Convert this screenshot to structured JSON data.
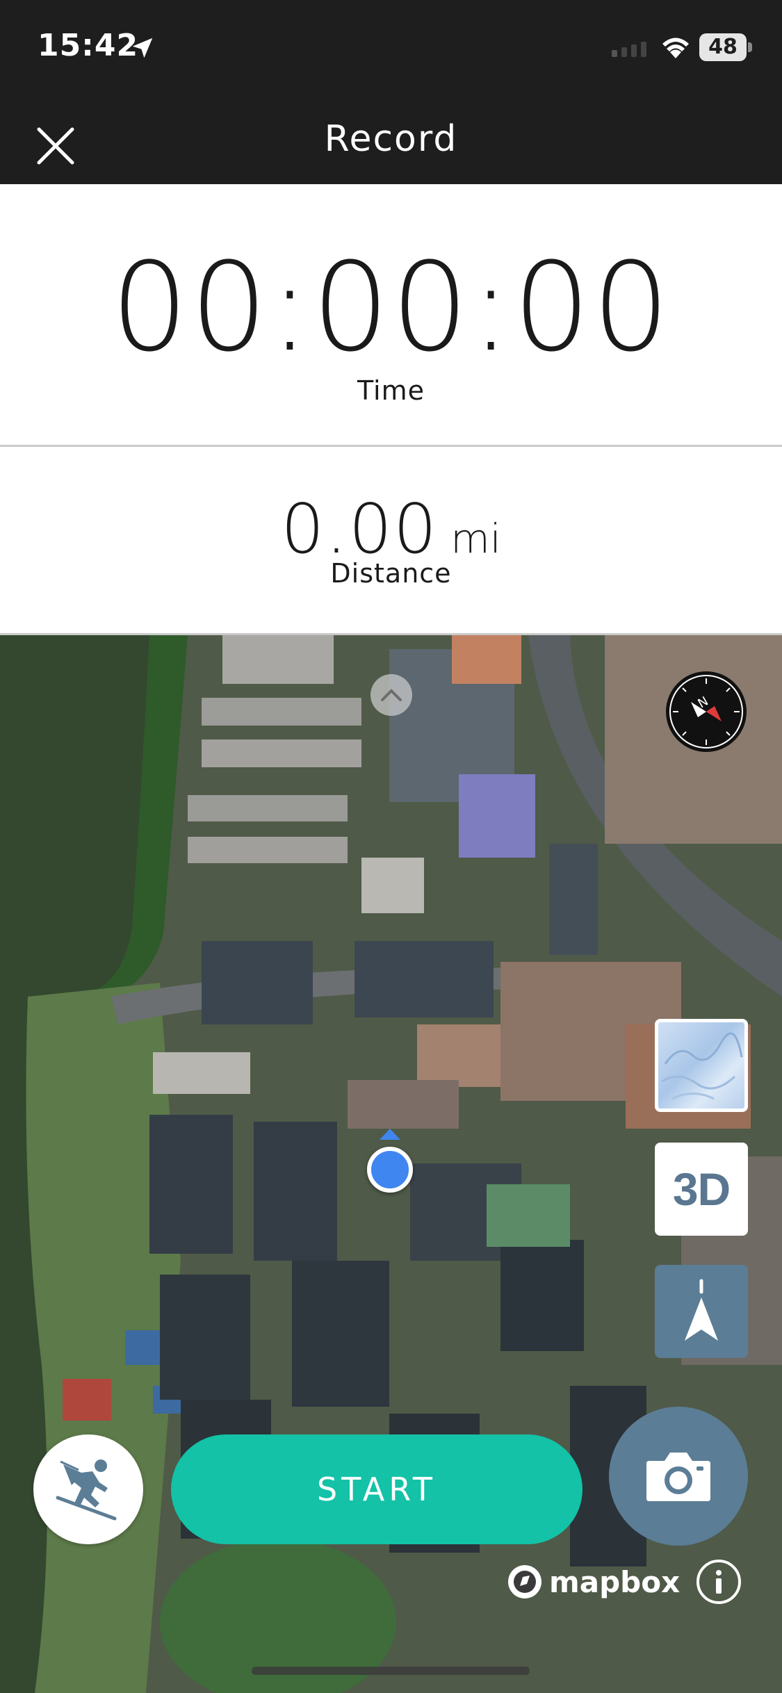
{
  "status_bar": {
    "time": "15:42",
    "battery": "48"
  },
  "header": {
    "title": "Record"
  },
  "timer": {
    "value": "00:00:00",
    "label": "Time"
  },
  "distance": {
    "value": "0.00",
    "unit": "mi",
    "label": "Distance"
  },
  "map": {
    "controls": {
      "three_d_label": "3D"
    },
    "attribution": "mapbox"
  },
  "actions": {
    "start_label": "START"
  },
  "icons": {
    "close": "close-icon",
    "location": "location-arrow-icon",
    "compass": "compass-icon",
    "terrain": "terrain-layer-icon",
    "heading": "heading-arrow-icon",
    "activity": "skiing-icon",
    "camera": "camera-icon",
    "info": "info-icon"
  },
  "colors": {
    "header_bg": "#1e1e1e",
    "start_button": "#13c2a7",
    "control_blue": "#5c7d96",
    "user_location": "#3f86f0"
  }
}
